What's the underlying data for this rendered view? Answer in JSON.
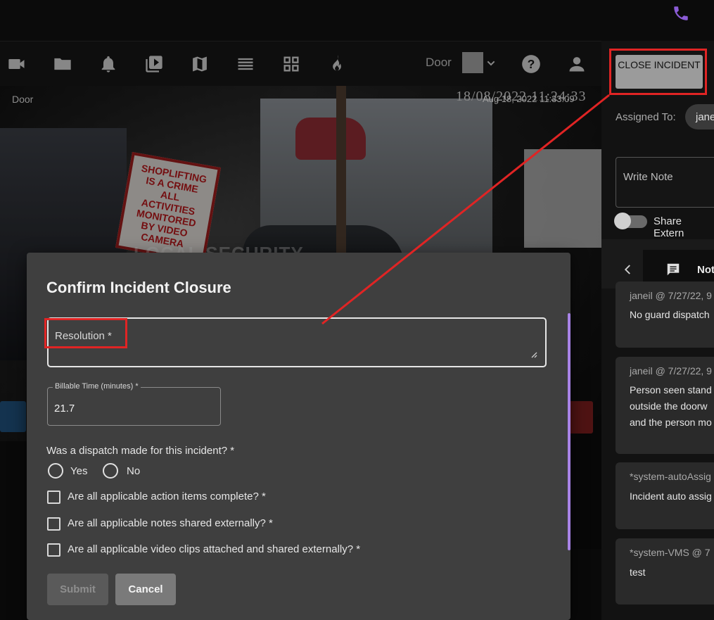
{
  "toolbar": {
    "icons": [
      "video-camera-icon",
      "folder-icon",
      "bell-icon",
      "video-library-icon",
      "map-icon",
      "list-icon",
      "grid-icon",
      "fire-icon"
    ],
    "door_label": "Door",
    "help_icon": "help-icon",
    "user_icon": "user-icon"
  },
  "camera": {
    "label": "Door",
    "overlay_timestamp": "18/08/2022 11:24:33",
    "timestamp": "Aug 18, 2022 11:33:09",
    "sign_text": "SHOPLIFTING IS A CRIME ALL ACTIVITIES MONITORED BY VIDEO CAMERA",
    "watermark": "LOCAL SECURITY"
  },
  "right_panel": {
    "close_incident_label": "CLOSE INCIDENT",
    "assigned_to_label": "Assigned To:",
    "assignee": "jane",
    "note_placeholder": "Write Note",
    "share_label": "Share Extern",
    "tab_notes_label": "Not",
    "notes": [
      {
        "header": "janeil @ 7/27/22, 9",
        "body": [
          "No guard dispatch"
        ]
      },
      {
        "header": "janeil @ 7/27/22, 9",
        "body": [
          "Person seen stand",
          "outside the doorw",
          "and the person mo"
        ]
      },
      {
        "header": "*system-autoAssig",
        "body": [
          "Incident auto assig"
        ]
      },
      {
        "header": "*system-VMS @ 7",
        "body": [
          "test"
        ]
      }
    ]
  },
  "modal": {
    "title": "Confirm Incident Closure",
    "resolution_label": "Resolution *",
    "billable_label": "Billable Time (minutes) *",
    "billable_value": "21.7",
    "dispatch_question": "Was a dispatch made for this incident? *",
    "yes_label": "Yes",
    "no_label": "No",
    "checks": [
      "Are all applicable action items complete? *",
      "Are all applicable notes shared externally? *",
      "Are all applicable video clips attached and shared externally? *"
    ],
    "submit_label": "Submit",
    "cancel_label": "Cancel"
  },
  "colors": {
    "accent": "#a883e6",
    "highlight": "#e02424",
    "modal_bg": "#3f3f3f"
  }
}
